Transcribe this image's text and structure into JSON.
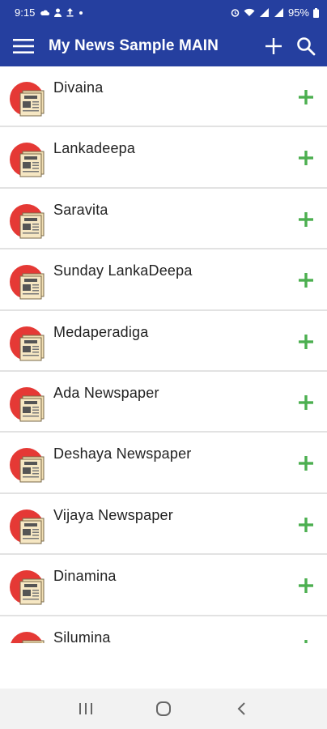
{
  "status_bar": {
    "time": "9:15",
    "battery": "95%",
    "icons": [
      "cloud-icon",
      "account-icon",
      "upload-icon",
      "dot-icon",
      "alarm-icon",
      "wifi-icon",
      "signal-icon",
      "battery-icon"
    ]
  },
  "app_bar": {
    "title": "My News Sample MAIN",
    "menu_icon": "menu-icon",
    "add_icon": "add-icon",
    "search_icon": "search-icon",
    "background": "#253f9f"
  },
  "list": {
    "items": [
      {
        "name": "Divaina"
      },
      {
        "name": "Lankadeepa"
      },
      {
        "name": "Saravita"
      },
      {
        "name": "Sunday LankaDeepa"
      },
      {
        "name": "Medaperadiga"
      },
      {
        "name": "Ada Newspaper"
      },
      {
        "name": "Deshaya Newspaper"
      },
      {
        "name": "Vijaya Newspaper"
      },
      {
        "name": "Dinamina"
      },
      {
        "name": "Silumina"
      }
    ],
    "item_icon": "newspaper-icon",
    "add_icon": "add-icon",
    "add_color": "#4caf50"
  },
  "nav_bar": {
    "icons": [
      "recent-apps-icon",
      "home-icon",
      "back-icon"
    ]
  }
}
